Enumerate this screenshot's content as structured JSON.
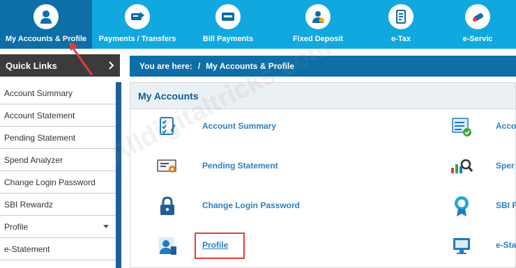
{
  "topnav": {
    "items": [
      {
        "label": "My Accounts & Profile",
        "icon": "user-icon",
        "active": true
      },
      {
        "label": "Payments / Transfers",
        "icon": "transfer-icon",
        "active": false
      },
      {
        "label": "Bill Payments",
        "icon": "bill-icon",
        "active": false
      },
      {
        "label": "Fixed Deposit",
        "icon": "deposit-icon",
        "active": false
      },
      {
        "label": "e-Tax",
        "icon": "tax-icon",
        "active": false
      },
      {
        "label": "e-Servic",
        "icon": "services-icon",
        "active": false
      }
    ]
  },
  "sidebar": {
    "header": "Quick Links",
    "items": [
      {
        "label": "Account Summary"
      },
      {
        "label": "Account Statement"
      },
      {
        "label": "Pending Statement"
      },
      {
        "label": "Spend Analyzer"
      },
      {
        "label": "Change Login Password"
      },
      {
        "label": "SBI Rewardz"
      },
      {
        "label": "Profile"
      },
      {
        "label": "e-Statement"
      }
    ]
  },
  "breadcrumb": {
    "prefix": "You are here:",
    "separator": "/",
    "current": "My Accounts & Profile"
  },
  "main": {
    "title": "My Accounts",
    "rows": [
      {
        "left": {
          "label": "Account Summary",
          "icon": "checklist-icon"
        },
        "right": {
          "label": "Acco",
          "icon": "list-check-icon"
        }
      },
      {
        "left": {
          "label": "Pending Statement",
          "icon": "certificate-icon"
        },
        "right": {
          "label": "Sper",
          "icon": "analyzer-icon"
        }
      },
      {
        "left": {
          "label": "Change Login Password",
          "icon": "lock-icon"
        },
        "right": {
          "label": "SBI F",
          "icon": "medal-icon"
        }
      },
      {
        "left": {
          "label": "Profile",
          "icon": "profile-icon"
        },
        "right": {
          "label": "e-Sta",
          "icon": "monitor-icon"
        }
      }
    ]
  },
  "watermark": "Alldigitaltricks.com",
  "colors": {
    "nav_bg": "#11a8e0",
    "nav_active": "#0d6ea8",
    "breadcrumb_bg": "#0d6ea8",
    "sidebar_header_bg": "#3b3b3b",
    "link": "#2e7fbf",
    "highlight": "#e23c3c"
  }
}
